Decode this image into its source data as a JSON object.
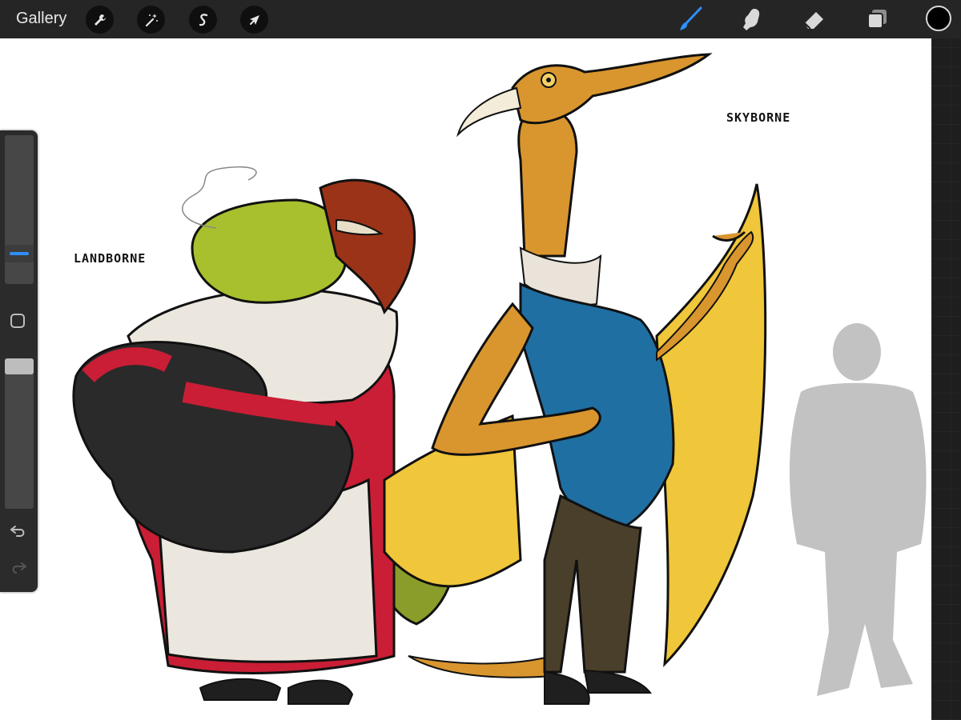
{
  "toolbar": {
    "gallery_label": "Gallery",
    "left_tools": [
      {
        "name": "actions",
        "icon": "wrench-icon"
      },
      {
        "name": "adjustments",
        "icon": "magic-wand-icon"
      },
      {
        "name": "selection",
        "icon": "selection-s-icon"
      },
      {
        "name": "transform",
        "icon": "arrow-cursor-icon"
      }
    ],
    "right_tools": [
      {
        "name": "brush",
        "icon": "brush-icon",
        "active": true
      },
      {
        "name": "smudge",
        "icon": "smudge-finger-icon",
        "active": false
      },
      {
        "name": "eraser",
        "icon": "eraser-icon",
        "active": false
      },
      {
        "name": "layers",
        "icon": "layers-icon",
        "active": false
      }
    ],
    "current_color": "#000000",
    "active_color": "#2f8fff"
  },
  "canvas": {
    "labels": {
      "left_character": "LANDBORNE",
      "right_character": "SKYBORNE"
    }
  },
  "sidebar": {
    "brush_size_icon": "size-slider",
    "opacity_icon": "opacity-slider",
    "modify_icon": "square-modify-icon",
    "undo_icon": "undo-icon",
    "redo_icon": "redo-icon"
  }
}
